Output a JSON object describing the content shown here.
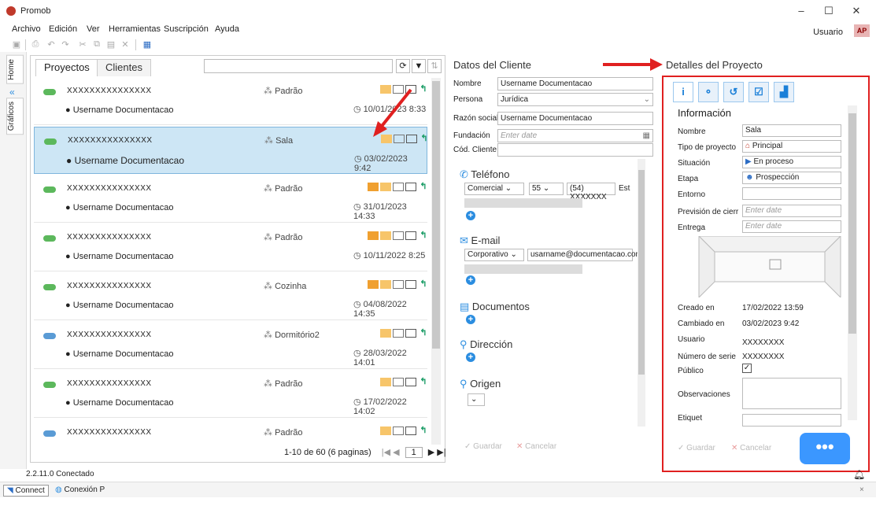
{
  "window": {
    "title": "Promob",
    "minimize": "–",
    "maximize": "☐",
    "close": "✕"
  },
  "menu": [
    "Archivo",
    "Edición",
    "Ver",
    "Herramientas",
    "Suscripción",
    "Ayuda"
  ],
  "user": {
    "label": "Usuario",
    "avatar": "AP"
  },
  "rail": {
    "home": "Home",
    "graficos": "Gráficos"
  },
  "projects": {
    "tabs": [
      "Proyectos",
      "Clientes"
    ],
    "rows": [
      {
        "code": "XXXXXXXXXXXXXXX",
        "user": "Username Documentacao",
        "type": "Padrão",
        "date": "10/01/2023 8:33",
        "cloud": "#5cb85c",
        "owner": false
      },
      {
        "code": "XXXXXXXXXXXXXXX",
        "user": "Username Documentacao",
        "type": "Sala",
        "date": "03/02/2023 9:42",
        "cloud": "#5cb85c",
        "owner": false,
        "selected": true
      },
      {
        "code": "XXXXXXXXXXXXXXX",
        "user": "Username Documentacao",
        "type": "Padrão",
        "date": "31/01/2023 14:33",
        "cloud": "#5cb85c",
        "owner": true
      },
      {
        "code": "XXXXXXXXXXXXXXX",
        "user": "Username Documentacao",
        "type": "Padrão",
        "date": "10/11/2022 8:25",
        "cloud": "#5cb85c",
        "owner": true
      },
      {
        "code": "XXXXXXXXXXXXXXX",
        "user": "Username Documentacao",
        "type": "Cozinha",
        "date": "04/08/2022 14:35",
        "cloud": "#5cb85c",
        "owner": true
      },
      {
        "code": "XXXXXXXXXXXXXXX",
        "user": "Username Documentacao",
        "type": "Dormitório2",
        "date": "28/03/2022 14:01",
        "cloud": "#5a9bd5",
        "owner": false
      },
      {
        "code": "XXXXXXXXXXXXXXX",
        "user": "Username Documentacao",
        "type": "Padrão",
        "date": "17/02/2022 14:02",
        "cloud": "#5cb85c",
        "owner": false
      },
      {
        "code": "XXXXXXXXXXXXXXX",
        "user": "",
        "type": "Padrão",
        "date": "",
        "cloud": "#5a9bd5",
        "owner": false
      }
    ],
    "pager": "1-10 de 60 (6 paginas)",
    "page": "1"
  },
  "client": {
    "header": "Datos del Cliente",
    "nombre_label": "Nombre",
    "nombre": "Username Documentacao",
    "persona_label": "Persona",
    "persona": "Jurídica",
    "razon_label": "Razón social",
    "razon": "Username Documentacao",
    "fundacion_label": "Fundación",
    "fundacion_ph": "Enter date",
    "cod_label": "Cód. Cliente",
    "telefono": "Teléfono",
    "tel_type": "Comercial",
    "tel_cc": "55",
    "tel_num": "(54) XXXXXXX",
    "tel_extra": "Est",
    "email": "E-mail",
    "email_type": "Corporativo",
    "email_val": "usarname@documentacao.com",
    "documentos": "Documentos",
    "direccion": "Dirección",
    "origen": "Origen",
    "guardar": "Guardar",
    "cancelar": "Cancelar"
  },
  "detail": {
    "header": "Detalles del Proyecto",
    "section": "Información",
    "nombre_label": "Nombre",
    "nombre": "Sala",
    "tipo_label": "Tipo de proyecto",
    "tipo": "Principal",
    "situacion_label": "Situación",
    "situacion": "En proceso",
    "etapa_label": "Etapa",
    "etapa": "Prospección",
    "entorno_label": "Entorno",
    "prevision_label": "Previsión de cierr",
    "entrega_label": "Entrega",
    "date_ph": "Enter date",
    "creado_label": "Creado en",
    "creado": "17/02/2022 13:59",
    "cambiado_label": "Cambiado en",
    "cambiado": "03/02/2023 9:42",
    "usuario_label": "Usuario",
    "usuario": "XXXXXXXX",
    "serie_label": "Número de serie",
    "serie": "XXXXXXXX",
    "publico_label": "Público",
    "obs_label": "Observaciones",
    "etiq_label": "Etiquet",
    "guardar": "Guardar",
    "cancelar": "Cancelar"
  },
  "status": {
    "version": "2.2.11.0 Conectado",
    "connect": "Connect",
    "conexion": "Conexión P"
  },
  "colors": {
    "accent": "#2b8de0",
    "selected_row": "#cde6f5",
    "highlight": "#e02020",
    "chat": "#3b97ff"
  }
}
